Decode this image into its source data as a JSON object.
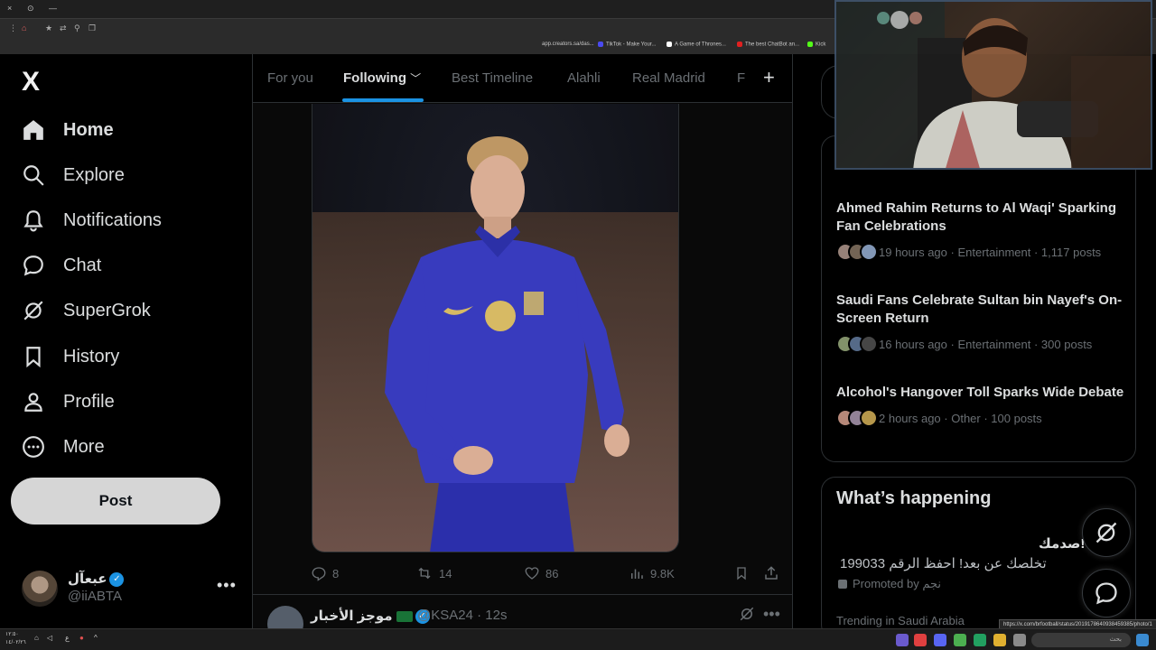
{
  "browser": {
    "window_controls": [
      "×",
      "⊙",
      "—"
    ],
    "bookmarks": [
      {
        "label": "app.creators.sa/das...",
        "color": "#e0e0e0"
      },
      {
        "label": "TikTok - Make Your...",
        "color": "#4a4af0"
      },
      {
        "label": "A Game of Thrones...",
        "color": "#222222"
      },
      {
        "label": "The best ChatBot an...",
        "color": "#e02020"
      },
      {
        "label": "Kick",
        "color": "#53fc18"
      }
    ],
    "status_url": "https://x.com/brfootball/status/2019178640938459385/photo/1"
  },
  "sidebar": {
    "logo": "X",
    "items": [
      {
        "label": "Home",
        "icon": "home-icon",
        "active": true
      },
      {
        "label": "Explore",
        "icon": "search-icon",
        "active": false
      },
      {
        "label": "Notifications",
        "icon": "bell-icon",
        "active": false
      },
      {
        "label": "Chat",
        "icon": "chat-bubble-icon",
        "active": false
      },
      {
        "label": "SuperGrok",
        "icon": "grok-icon",
        "active": false
      },
      {
        "label": "History",
        "icon": "bookmark-icon",
        "active": false
      },
      {
        "label": "Profile",
        "icon": "person-icon",
        "active": false
      },
      {
        "label": "More",
        "icon": "more-circle-icon",
        "active": false
      }
    ],
    "post_label": "Post",
    "account": {
      "name": "عبعآل",
      "handle": "@iiABTA",
      "more": "•••"
    }
  },
  "timeline": {
    "tabs": [
      {
        "label": "For you",
        "active": false
      },
      {
        "label": "Following",
        "active": true
      },
      {
        "label": "Best Timeline",
        "active": false
      },
      {
        "label": "Alahli",
        "active": false
      },
      {
        "label": "Real Madrid",
        "active": false
      },
      {
        "label": "F",
        "active": false
      }
    ],
    "add_tab": "+",
    "tweet_actions": {
      "replies": "8",
      "reposts": "14",
      "likes": "86",
      "views": "9.8K"
    },
    "next_tweet": {
      "name": "موجز الأخبار",
      "handle": "@KSA24 · 12s",
      "more": "•••"
    }
  },
  "right": {
    "trends": [
      {
        "title": "Ahmed Rahim Returns to Al Waqi' Sparking Fan Celebrations",
        "meta": "19 hours ago · Entertainment · 1,117 posts"
      },
      {
        "title": "Saudi Fans Celebrate Sultan bin Nayef's On-Screen Return",
        "meta": "16 hours ago · Entertainment · 300 posts"
      },
      {
        "title": "Alcohol's Hangover Toll Sparks Wide Debate",
        "meta": "2 hours ago · Other · 100 posts"
      }
    ],
    "happening": {
      "title": "What’s happening",
      "promo_headline": "صدمك!",
      "promo_text": "تخلصك عن بعد! احفظ الرقم 199033",
      "promoted_by": "Promoted by نجم",
      "trending_region": "Trending in Saudi Arabia"
    }
  },
  "taskbar": {
    "time": "١٢:٥٠",
    "date": "١٤/٠٢/٢٦",
    "lang": "ع",
    "search": "بحث"
  },
  "colors": {
    "accent": "#1d9bf0",
    "jersey": "#3b3fc9",
    "background": "#000000"
  }
}
